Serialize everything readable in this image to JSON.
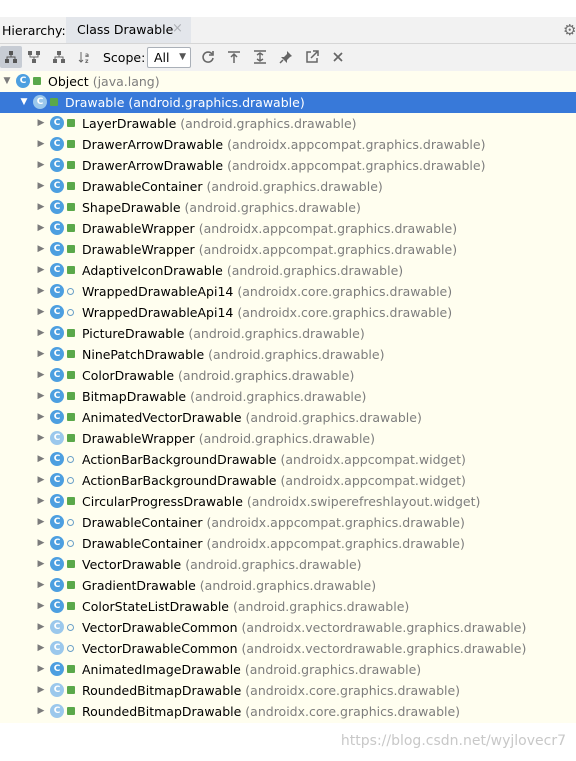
{
  "header": {
    "label": "Hierarchy:",
    "tab_title": "Class Drawable",
    "tab_close": "×"
  },
  "toolbar": {
    "scope_label": "Scope:",
    "scope_value": "All"
  },
  "tree": [
    {
      "depth": 0,
      "expanded": true,
      "name": "Object",
      "pkg": "(java.lang)",
      "vis": "pub",
      "icon": "class"
    },
    {
      "depth": 1,
      "expanded": true,
      "selected": true,
      "name": "Drawable",
      "pkg": "(android.graphics.drawable)",
      "vis": "pub",
      "icon": "abstract"
    },
    {
      "depth": 2,
      "name": "LayerDrawable",
      "pkg": "(android.graphics.drawable)",
      "vis": "pub",
      "icon": "class"
    },
    {
      "depth": 2,
      "name": "DrawerArrowDrawable",
      "pkg": "(androidx.appcompat.graphics.drawable)",
      "vis": "pub",
      "icon": "class"
    },
    {
      "depth": 2,
      "name": "DrawerArrowDrawable",
      "pkg": "(androidx.appcompat.graphics.drawable)",
      "vis": "pub",
      "icon": "class"
    },
    {
      "depth": 2,
      "name": "DrawableContainer",
      "pkg": "(android.graphics.drawable)",
      "vis": "pub",
      "icon": "class"
    },
    {
      "depth": 2,
      "name": "ShapeDrawable",
      "pkg": "(android.graphics.drawable)",
      "vis": "pub",
      "icon": "class"
    },
    {
      "depth": 2,
      "name": "DrawableWrapper",
      "pkg": "(androidx.appcompat.graphics.drawable)",
      "vis": "pub",
      "icon": "class"
    },
    {
      "depth": 2,
      "name": "DrawableWrapper",
      "pkg": "(androidx.appcompat.graphics.drawable)",
      "vis": "pub",
      "icon": "class"
    },
    {
      "depth": 2,
      "name": "AdaptiveIconDrawable",
      "pkg": "(android.graphics.drawable)",
      "vis": "pub",
      "icon": "class"
    },
    {
      "depth": 2,
      "name": "WrappedDrawableApi14",
      "pkg": "(androidx.core.graphics.drawable)",
      "vis": "pkg",
      "icon": "class"
    },
    {
      "depth": 2,
      "name": "WrappedDrawableApi14",
      "pkg": "(androidx.core.graphics.drawable)",
      "vis": "pkg",
      "icon": "class"
    },
    {
      "depth": 2,
      "name": "PictureDrawable",
      "pkg": "(android.graphics.drawable)",
      "vis": "pub",
      "icon": "class"
    },
    {
      "depth": 2,
      "name": "NinePatchDrawable",
      "pkg": "(android.graphics.drawable)",
      "vis": "pub",
      "icon": "class"
    },
    {
      "depth": 2,
      "name": "ColorDrawable",
      "pkg": "(android.graphics.drawable)",
      "vis": "pub",
      "icon": "class"
    },
    {
      "depth": 2,
      "name": "BitmapDrawable",
      "pkg": "(android.graphics.drawable)",
      "vis": "pub",
      "icon": "class"
    },
    {
      "depth": 2,
      "name": "AnimatedVectorDrawable",
      "pkg": "(android.graphics.drawable)",
      "vis": "pub",
      "icon": "class"
    },
    {
      "depth": 2,
      "name": "DrawableWrapper",
      "pkg": "(android.graphics.drawable)",
      "vis": "pub",
      "icon": "abstract"
    },
    {
      "depth": 2,
      "name": "ActionBarBackgroundDrawable",
      "pkg": "(androidx.appcompat.widget)",
      "vis": "pkg",
      "icon": "class"
    },
    {
      "depth": 2,
      "name": "ActionBarBackgroundDrawable",
      "pkg": "(androidx.appcompat.widget)",
      "vis": "pkg",
      "icon": "class"
    },
    {
      "depth": 2,
      "name": "CircularProgressDrawable",
      "pkg": "(androidx.swiperefreshlayout.widget)",
      "vis": "pub",
      "icon": "class"
    },
    {
      "depth": 2,
      "name": "DrawableContainer",
      "pkg": "(androidx.appcompat.graphics.drawable)",
      "vis": "pkg",
      "icon": "class"
    },
    {
      "depth": 2,
      "name": "DrawableContainer",
      "pkg": "(androidx.appcompat.graphics.drawable)",
      "vis": "pkg",
      "icon": "class"
    },
    {
      "depth": 2,
      "name": "VectorDrawable",
      "pkg": "(android.graphics.drawable)",
      "vis": "pub",
      "icon": "class"
    },
    {
      "depth": 2,
      "name": "GradientDrawable",
      "pkg": "(android.graphics.drawable)",
      "vis": "pub",
      "icon": "class"
    },
    {
      "depth": 2,
      "name": "ColorStateListDrawable",
      "pkg": "(android.graphics.drawable)",
      "vis": "pub",
      "icon": "class"
    },
    {
      "depth": 2,
      "name": "VectorDrawableCommon",
      "pkg": "(androidx.vectordrawable.graphics.drawable)",
      "vis": "pkg",
      "icon": "abstract"
    },
    {
      "depth": 2,
      "name": "VectorDrawableCommon",
      "pkg": "(androidx.vectordrawable.graphics.drawable)",
      "vis": "pkg",
      "icon": "abstract"
    },
    {
      "depth": 2,
      "name": "AnimatedImageDrawable",
      "pkg": "(android.graphics.drawable)",
      "vis": "pub",
      "icon": "class"
    },
    {
      "depth": 2,
      "name": "RoundedBitmapDrawable",
      "pkg": "(androidx.core.graphics.drawable)",
      "vis": "pub",
      "icon": "abstract"
    },
    {
      "depth": 2,
      "name": "RoundedBitmapDrawable",
      "pkg": "(androidx.core.graphics.drawable)",
      "vis": "pub",
      "icon": "abstract"
    }
  ],
  "icons": {
    "class_letter": "C",
    "gear": "⚙"
  },
  "watermark": "https://blog.csdn.net/wyjlovecr7"
}
